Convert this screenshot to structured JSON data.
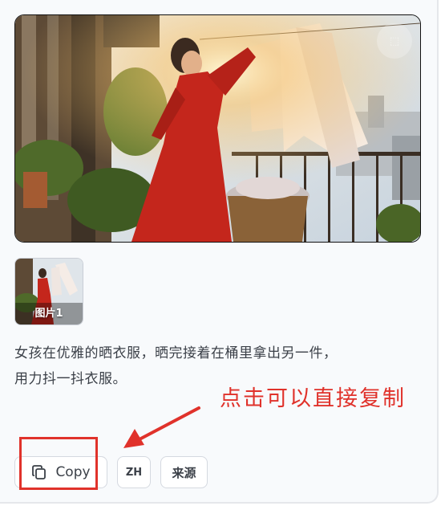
{
  "gallery": {
    "hero_image_alt": "",
    "thumbnail_label": "图片1"
  },
  "description": {
    "line1": "女孩在优雅的晒衣服，晒完接着在桶里拿出另一件，",
    "line2": "用力抖一抖衣服。"
  },
  "annotation": {
    "text": "点击可以直接复制",
    "color": "#e0322b"
  },
  "actions": {
    "copy_label": "Copy",
    "lang_label": "ZH",
    "source_label": "来源"
  },
  "icons": {
    "copy": "copy-icon",
    "hero_corner": "hero-corner-icon"
  }
}
